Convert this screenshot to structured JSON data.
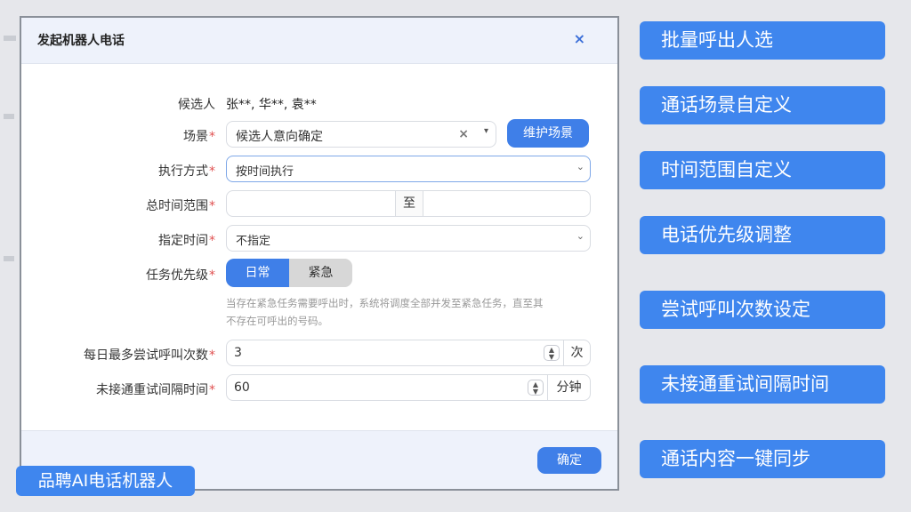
{
  "dialog": {
    "title": "发起机器人电话",
    "close_glyph": "×",
    "candidates": {
      "label": "候选人",
      "value": "张**, 华**, 袁**"
    },
    "scene": {
      "label": "场景",
      "required": "*",
      "value": "候选人意向确定",
      "clear_glyph": "×",
      "chevron": "▾",
      "maintain_button": "维护场景"
    },
    "execution_mode": {
      "label": "执行方式",
      "required": "*",
      "value": "按时间执行",
      "chevron": "⌄"
    },
    "time_range": {
      "label": "总时间范围",
      "required": "*",
      "start": "",
      "separator": "至",
      "end": ""
    },
    "designated_time": {
      "label": "指定时间",
      "required": "*",
      "value": "不指定",
      "chevron": "⌄"
    },
    "priority": {
      "label": "任务优先级",
      "required": "*",
      "options": [
        "日常",
        "紧急"
      ],
      "selected": "日常",
      "hint_line1": "当存在紧急任务需要呼出时，系统将调度全部并发至紧急任务，直至其",
      "hint_line2": "不存在可呼出的号码。"
    },
    "max_attempts": {
      "label": "每日最多尝试呼叫次数",
      "required": "*",
      "value": "3",
      "unit": "次"
    },
    "retry_interval": {
      "label": "未接通重试间隔时间",
      "required": "*",
      "value": "60",
      "unit": "分钟"
    },
    "confirm_button": "确定"
  },
  "features": [
    "批量呼出人选",
    "通话场景自定义",
    "时间范围自定义",
    "电话优先级调整",
    "尝试呼叫次数设定",
    "未接通重试间隔时间",
    "通话内容一键同步"
  ],
  "brand_label": "品聘AI电话机器人",
  "colors": {
    "accent": "#3f86ee",
    "button": "#3f7fe8",
    "required": "#e05050",
    "header_bg": "#eef2fb"
  }
}
